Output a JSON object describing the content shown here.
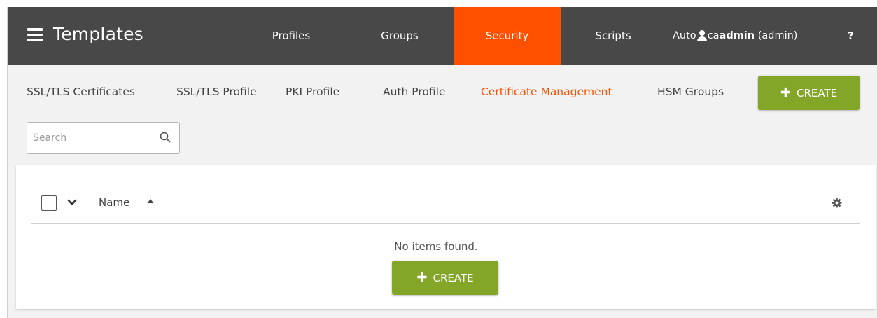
{
  "header": {
    "title": "Templates",
    "nav": [
      {
        "label": "Profiles"
      },
      {
        "label": "Groups"
      },
      {
        "label": "Security"
      },
      {
        "label": "Scripts"
      }
    ],
    "user": {
      "context": "Auto",
      "overlap": "ca",
      "name": "admin",
      "role": "(admin)"
    },
    "help_label": "?"
  },
  "subnav": {
    "items": [
      {
        "label": "SSL/TLS Certificates"
      },
      {
        "label": "SSL/TLS Profile"
      },
      {
        "label": "PKI Profile"
      },
      {
        "label": "Auth Profile"
      },
      {
        "label": "Certificate Management"
      },
      {
        "label": "HSM Groups"
      }
    ],
    "create_label": "CREATE"
  },
  "search": {
    "placeholder": "Search",
    "value": ""
  },
  "table": {
    "column_name": "Name",
    "empty_message": "No items found.",
    "create_label": "CREATE"
  },
  "colors": {
    "topbar": "#484848",
    "accent": "#ff5000",
    "create_green": "#83a629",
    "background": "#f2f2f2"
  },
  "icons": {
    "menu": "hamburger-menu-icon",
    "user": "user-icon",
    "search": "search-icon",
    "chevron": "chevron-down-icon",
    "sort": "sort-ascending-icon",
    "settings": "gear-icon",
    "add": "plus-icon"
  }
}
